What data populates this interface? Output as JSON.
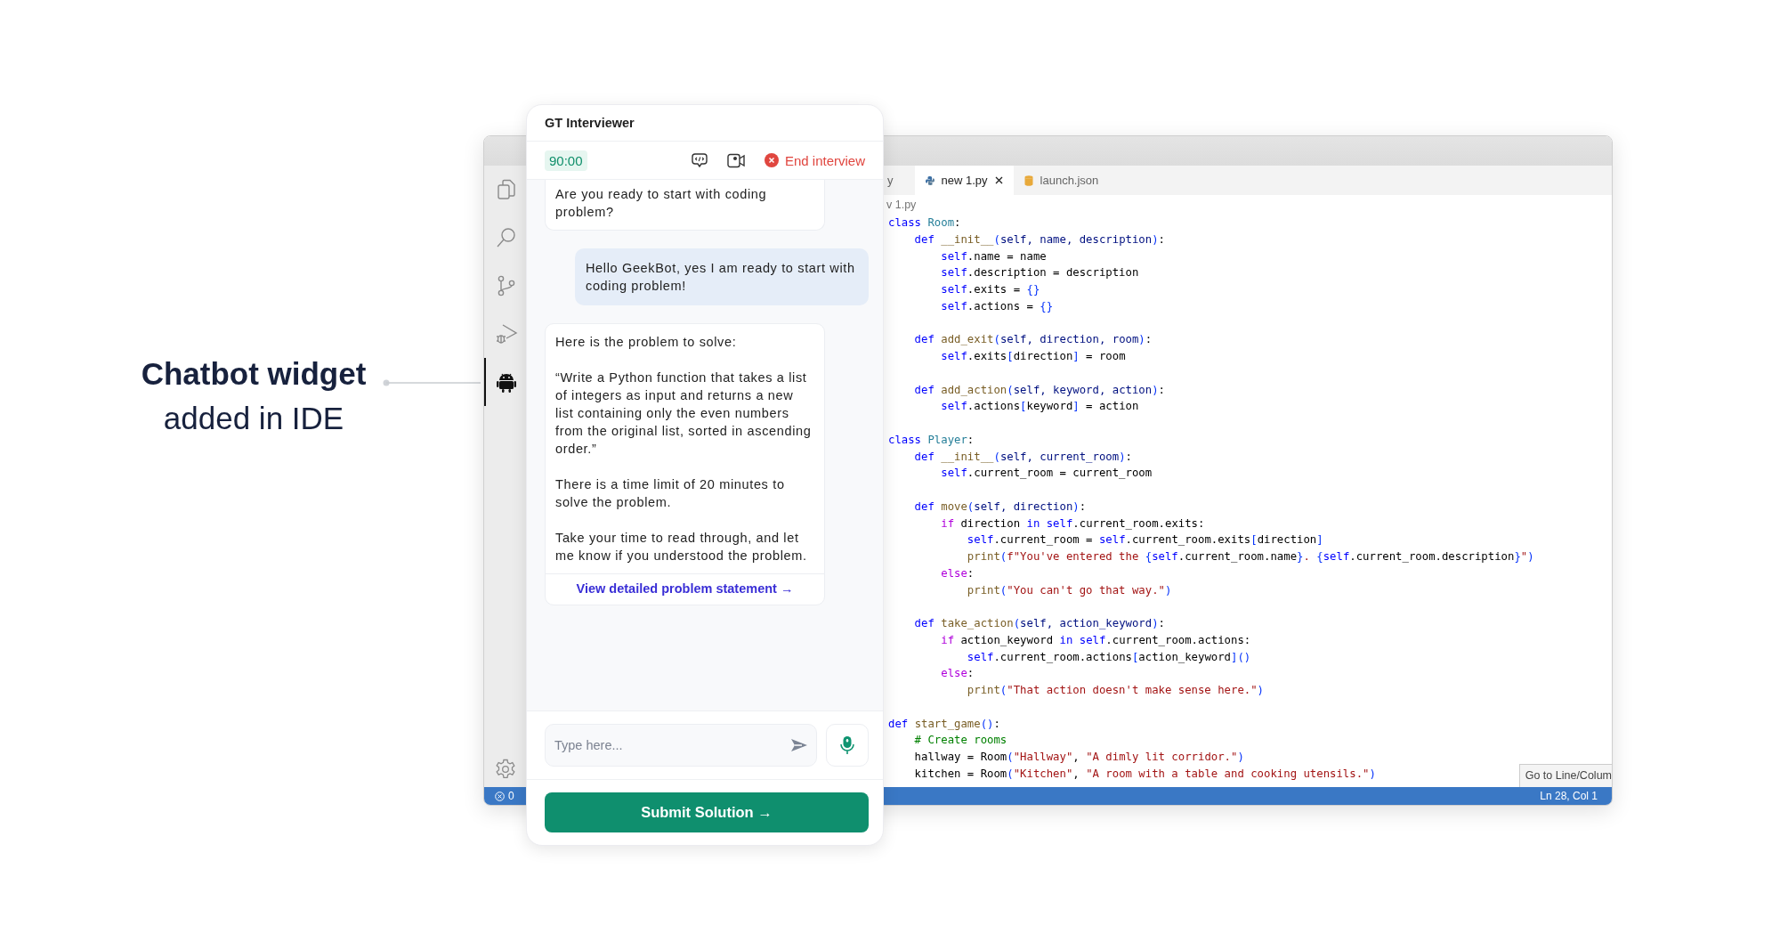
{
  "caption": {
    "title": "Chatbot widget",
    "subtitle": "added in IDE"
  },
  "ide": {
    "activity_bar": [
      {
        "kind": "files",
        "selected": false
      },
      {
        "kind": "search",
        "selected": false
      },
      {
        "kind": "source-control",
        "selected": false
      },
      {
        "kind": "run-debug",
        "selected": false
      },
      {
        "kind": "chatbot",
        "selected": true
      }
    ],
    "tabs": [
      {
        "label": "y",
        "selected": false,
        "kind": "plain"
      },
      {
        "label": "new 1.py",
        "selected": true,
        "kind": "python"
      },
      {
        "label": "launch.json",
        "selected": false,
        "kind": "json"
      }
    ],
    "breadcrumb": "v 1.py",
    "code": [
      {
        "kind": "code",
        "tokens": [
          {
            "kind": "kw",
            "text": "class "
          },
          {
            "kind": "cls",
            "text": "Room"
          },
          {
            "kind": "p",
            "text": ":"
          }
        ]
      },
      {
        "kind": "code",
        "tokens": [
          {
            "kind": "kw",
            "text": "    def "
          },
          {
            "kind": "fn",
            "text": "__init__"
          },
          {
            "kind": "br",
            "text": "("
          },
          {
            "kind": "pa",
            "text": "self, name, description"
          },
          {
            "kind": "br",
            "text": ")"
          },
          {
            "kind": "p",
            "text": ":"
          }
        ]
      },
      {
        "kind": "code",
        "tokens": [
          {
            "kind": "self",
            "text": "        self"
          },
          {
            "kind": "p",
            "text": ".name = name"
          }
        ]
      },
      {
        "kind": "code",
        "tokens": [
          {
            "kind": "self",
            "text": "        self"
          },
          {
            "kind": "p",
            "text": ".description = description"
          }
        ]
      },
      {
        "kind": "code",
        "tokens": [
          {
            "kind": "self",
            "text": "        self"
          },
          {
            "kind": "p",
            "text": ".exits = "
          },
          {
            "kind": "br",
            "text": "{}"
          }
        ]
      },
      {
        "kind": "code",
        "tokens": [
          {
            "kind": "self",
            "text": "        self"
          },
          {
            "kind": "p",
            "text": ".actions = "
          },
          {
            "kind": "br",
            "text": "{}"
          }
        ]
      },
      {
        "kind": "blank"
      },
      {
        "kind": "code",
        "tokens": [
          {
            "kind": "kw",
            "text": "    def "
          },
          {
            "kind": "fn",
            "text": "add_exit"
          },
          {
            "kind": "br",
            "text": "("
          },
          {
            "kind": "pa",
            "text": "self, direction, room"
          },
          {
            "kind": "br",
            "text": ")"
          },
          {
            "kind": "p",
            "text": ":"
          }
        ]
      },
      {
        "kind": "code",
        "tokens": [
          {
            "kind": "self",
            "text": "        self"
          },
          {
            "kind": "p",
            "text": ".exits"
          },
          {
            "kind": "br",
            "text": "["
          },
          {
            "kind": "p",
            "text": "direction"
          },
          {
            "kind": "br",
            "text": "]"
          },
          {
            "kind": "p",
            "text": " = room"
          }
        ]
      },
      {
        "kind": "blank"
      },
      {
        "kind": "code",
        "tokens": [
          {
            "kind": "kw",
            "text": "    def "
          },
          {
            "kind": "fn",
            "text": "add_action"
          },
          {
            "kind": "br",
            "text": "("
          },
          {
            "kind": "pa",
            "text": "self, keyword, action"
          },
          {
            "kind": "br",
            "text": ")"
          },
          {
            "kind": "p",
            "text": ":"
          }
        ]
      },
      {
        "kind": "code",
        "tokens": [
          {
            "kind": "self",
            "text": "        self"
          },
          {
            "kind": "p",
            "text": ".actions"
          },
          {
            "kind": "br",
            "text": "["
          },
          {
            "kind": "p",
            "text": "keyword"
          },
          {
            "kind": "br",
            "text": "]"
          },
          {
            "kind": "p",
            "text": " = action"
          }
        ]
      },
      {
        "kind": "blank"
      },
      {
        "kind": "code",
        "tokens": [
          {
            "kind": "kw",
            "text": "class "
          },
          {
            "kind": "cls",
            "text": "Player"
          },
          {
            "kind": "p",
            "text": ":"
          }
        ]
      },
      {
        "kind": "code",
        "tokens": [
          {
            "kind": "kw",
            "text": "    def "
          },
          {
            "kind": "fn",
            "text": "__init__"
          },
          {
            "kind": "br",
            "text": "("
          },
          {
            "kind": "pa",
            "text": "self, current_room"
          },
          {
            "kind": "br",
            "text": ")"
          },
          {
            "kind": "p",
            "text": ":"
          }
        ]
      },
      {
        "kind": "code",
        "tokens": [
          {
            "kind": "self",
            "text": "        self"
          },
          {
            "kind": "p",
            "text": ".current_room = current_room"
          }
        ]
      },
      {
        "kind": "blank"
      },
      {
        "kind": "code",
        "tokens": [
          {
            "kind": "kw",
            "text": "    def "
          },
          {
            "kind": "fn",
            "text": "move"
          },
          {
            "kind": "br",
            "text": "("
          },
          {
            "kind": "pa",
            "text": "self, direction"
          },
          {
            "kind": "br",
            "text": ")"
          },
          {
            "kind": "p",
            "text": ":"
          }
        ]
      },
      {
        "kind": "code",
        "tokens": [
          {
            "kind": "ctl",
            "text": "        if"
          },
          {
            "kind": "p",
            "text": " direction "
          },
          {
            "kind": "kw",
            "text": "in "
          },
          {
            "kind": "self",
            "text": "self"
          },
          {
            "kind": "p",
            "text": ".current_room.exits:"
          }
        ]
      },
      {
        "kind": "code",
        "tokens": [
          {
            "kind": "self",
            "text": "            self"
          },
          {
            "kind": "p",
            "text": ".current_room = "
          },
          {
            "kind": "self",
            "text": "self"
          },
          {
            "kind": "p",
            "text": ".current_room.exits"
          },
          {
            "kind": "br",
            "text": "["
          },
          {
            "kind": "p",
            "text": "direction"
          },
          {
            "kind": "br",
            "text": "]"
          }
        ]
      },
      {
        "kind": "code",
        "tokens": [
          {
            "kind": "fn",
            "text": "            print"
          },
          {
            "kind": "br",
            "text": "("
          },
          {
            "kind": "str",
            "text": "f\"You've entered the "
          },
          {
            "kind": "br",
            "text": "{"
          },
          {
            "kind": "self",
            "text": "self"
          },
          {
            "kind": "p",
            "text": ".current_room.name"
          },
          {
            "kind": "br",
            "text": "}"
          },
          {
            "kind": "str",
            "text": ". "
          },
          {
            "kind": "br",
            "text": "{"
          },
          {
            "kind": "self",
            "text": "self"
          },
          {
            "kind": "p",
            "text": ".current_room.description"
          },
          {
            "kind": "br",
            "text": "}"
          },
          {
            "kind": "str",
            "text": "\""
          },
          {
            "kind": "br",
            "text": ")"
          }
        ]
      },
      {
        "kind": "code",
        "tokens": [
          {
            "kind": "ctl",
            "text": "        else"
          },
          {
            "kind": "p",
            "text": ":"
          }
        ]
      },
      {
        "kind": "code",
        "tokens": [
          {
            "kind": "fn",
            "text": "            print"
          },
          {
            "kind": "br",
            "text": "("
          },
          {
            "kind": "str",
            "text": "\"You can't go that way.\""
          },
          {
            "kind": "br",
            "text": ")"
          }
        ]
      },
      {
        "kind": "blank"
      },
      {
        "kind": "code",
        "tokens": [
          {
            "kind": "kw",
            "text": "    def "
          },
          {
            "kind": "fn",
            "text": "take_action"
          },
          {
            "kind": "br",
            "text": "("
          },
          {
            "kind": "pa",
            "text": "self, action_keyword"
          },
          {
            "kind": "br",
            "text": ")"
          },
          {
            "kind": "p",
            "text": ":"
          }
        ]
      },
      {
        "kind": "code",
        "tokens": [
          {
            "kind": "ctl",
            "text": "        if"
          },
          {
            "kind": "p",
            "text": " action_keyword "
          },
          {
            "kind": "kw",
            "text": "in "
          },
          {
            "kind": "self",
            "text": "self"
          },
          {
            "kind": "p",
            "text": ".current_room.actions:"
          }
        ]
      },
      {
        "kind": "code",
        "tokens": [
          {
            "kind": "self",
            "text": "            self"
          },
          {
            "kind": "p",
            "text": ".current_room.actions"
          },
          {
            "kind": "br",
            "text": "["
          },
          {
            "kind": "p",
            "text": "action_keyword"
          },
          {
            "kind": "br",
            "text": "]()"
          }
        ]
      },
      {
        "kind": "code",
        "tokens": [
          {
            "kind": "ctl",
            "text": "        else"
          },
          {
            "kind": "p",
            "text": ":"
          }
        ]
      },
      {
        "kind": "code",
        "tokens": [
          {
            "kind": "fn",
            "text": "            print"
          },
          {
            "kind": "br",
            "text": "("
          },
          {
            "kind": "str",
            "text": "\"That action doesn't make sense here.\""
          },
          {
            "kind": "br",
            "text": ")"
          }
        ]
      },
      {
        "kind": "blank"
      },
      {
        "kind": "code",
        "tokens": [
          {
            "kind": "kw",
            "text": "def "
          },
          {
            "kind": "fn",
            "text": "start_game"
          },
          {
            "kind": "br",
            "text": "()"
          },
          {
            "kind": "p",
            "text": ":"
          }
        ]
      },
      {
        "kind": "code",
        "tokens": [
          {
            "kind": "com",
            "text": "    # Create rooms"
          }
        ]
      },
      {
        "kind": "code",
        "tokens": [
          {
            "kind": "p",
            "text": "    hallway = Room"
          },
          {
            "kind": "br",
            "text": "("
          },
          {
            "kind": "str",
            "text": "\"Hallway\""
          },
          {
            "kind": "p",
            "text": ", "
          },
          {
            "kind": "str",
            "text": "\"A dimly lit corridor.\""
          },
          {
            "kind": "br",
            "text": ")"
          }
        ]
      },
      {
        "kind": "code",
        "tokens": [
          {
            "kind": "p",
            "text": "    kitchen = Room"
          },
          {
            "kind": "br",
            "text": "("
          },
          {
            "kind": "str",
            "text": "\"Kitchen\""
          },
          {
            "kind": "p",
            "text": ", "
          },
          {
            "kind": "str",
            "text": "\"A room with a table and cooking utensils.\""
          },
          {
            "kind": "br",
            "text": ")"
          }
        ]
      }
    ],
    "popup": "Go to Line/Colum",
    "status_bar": {
      "errors": "0",
      "position": "Ln 28, Col 1"
    }
  },
  "chat": {
    "title": "GT Interviewer",
    "timer": "90:00",
    "end_button": "End interview",
    "messages": [
      {
        "kind": "bot",
        "paragraphs": [
          "Are you ready to start with coding problem?"
        ]
      },
      {
        "kind": "user",
        "paragraphs": [
          "Hello GeekBot, yes I am ready to start with coding problem!"
        ]
      },
      {
        "kind": "bot",
        "paragraphs": [
          "Here is the problem to solve:",
          "“Write a Python function that takes a list of integers as input and returns a new list containing only the even numbers from the original list, sorted in ascending order.”",
          "There is a time limit of 20 minutes to solve the problem.",
          "Take your time to read through, and let me know if you understood the problem."
        ],
        "link": "View detailed problem statement →"
      }
    ],
    "input": {
      "placeholder": "Type here..."
    },
    "submit": "Submit Solution →"
  }
}
